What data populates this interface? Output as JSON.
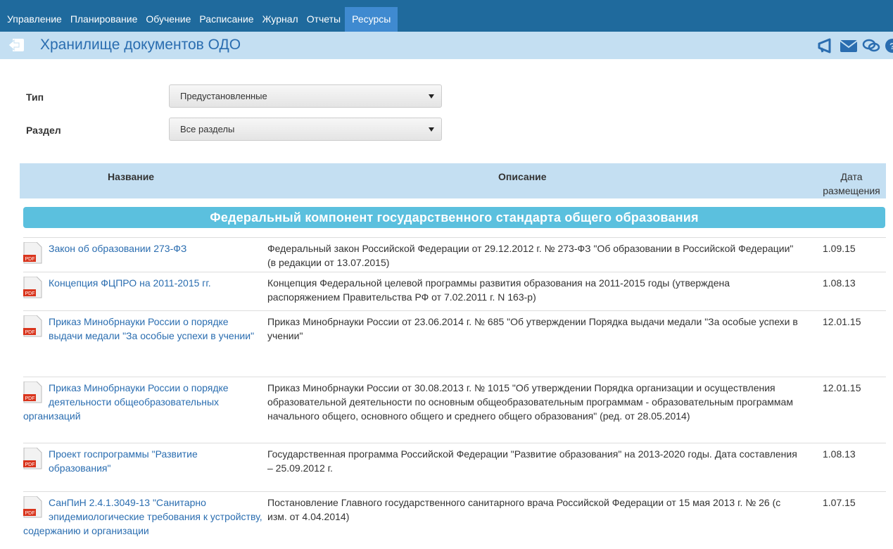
{
  "nav": {
    "items": [
      "Управление",
      "Планирование",
      "Обучение",
      "Расписание",
      "Журнал",
      "Отчеты",
      "Ресурсы"
    ],
    "active": "Ресурсы"
  },
  "header": {
    "title": "Хранилище документов ОДО",
    "icons": [
      "back-icon",
      "megaphone-icon",
      "envelope-icon",
      "chat-icon",
      "help-icon"
    ]
  },
  "filters": {
    "type_label": "Тип",
    "type_value": "Предустановленные",
    "section_label": "Раздел",
    "section_value": "Все разделы"
  },
  "table": {
    "col_name": "Название",
    "col_desc": "Описание",
    "col_date_1": "Дата",
    "col_date_2": "размещения",
    "section_title": "Федеральный компонент государственного стандарта общего образования",
    "rows": [
      {
        "name": "Закон об образовании 273-ФЗ",
        "desc": "Федеральный закон Российской Федерации от 29.12.2012 г. № 273-ФЗ \"Об образовании в Российской Федерации\" (в редакции от 13.07.2015)",
        "date": "1.09.15"
      },
      {
        "name": "Концепция ФЦПРО на 2011-2015 гг.",
        "desc": "Концепция Федеральной целевой программы развития образования на 2011-2015 годы (утверждена распоряжением Правительства РФ от 7.02.2011 г. N 163-р)",
        "date": "1.08.13"
      },
      {
        "name": "Приказ Минобрнауки России о порядке выдачи медали \"За особые успехи в учении\"",
        "desc": "Приказ Минобрнауки России от 23.06.2014 г. № 685 \"Об утверждении Порядка выдачи медали \"За особые успехи в учении\"",
        "date": "12.01.15"
      },
      {
        "name": "Приказ Минобрнауки России о порядке деятельности общеобразовательных организаций",
        "desc": "Приказ Минобрнауки России от 30.08.2013 г. № 1015 \"Об утверждении Порядка организации и осуществления образовательной деятельности по основным общеобразовательным программам - образовательным программам начального общего, основного общего и среднего общего образования\" (ред. от 28.05.2014)",
        "date": "12.01.15"
      },
      {
        "name": "Проект госпрограммы \"Развитие образования\"",
        "desc": "Государственная программа Российской Федерации \"Развитие образования\" на 2013-2020 годы. Дата составления – 25.09.2012 г.",
        "date": "1.08.13"
      },
      {
        "name": "СанПиН 2.4.1.3049-13 \"Санитарно эпидемиологические требования к устройству, содержанию и организации",
        "desc": "Постановление Главного государственного санитарного врача Российской Федерации от 15 мая 2013 г. № 26 (с изм. от 4.04.2014)",
        "date": "1.07.15"
      }
    ]
  },
  "icons": {
    "pdf_badge": "PDF"
  },
  "colors": {
    "nav_bg": "#1f6a9d",
    "nav_active": "#3f8ad0",
    "title_bar": "#c4dff2",
    "link": "#2a6db0",
    "section_bar": "#5bc0de"
  }
}
